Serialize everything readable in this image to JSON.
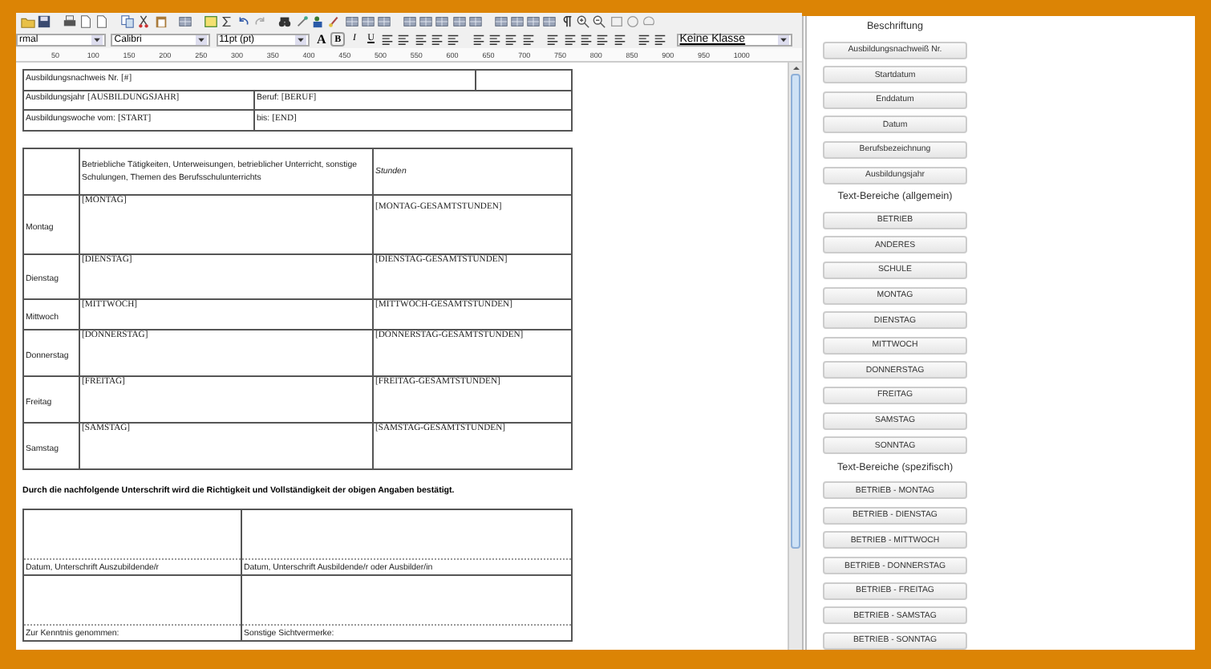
{
  "toolbar": {
    "style_select": "rmal",
    "font_select": "Calibri",
    "size_select": "11pt (pt)",
    "format_buttons": [
      "A",
      "B",
      "I",
      "U"
    ],
    "class_select": "Keine Klasse"
  },
  "ruler": [
    "50",
    "100",
    "150",
    "200",
    "250",
    "300",
    "350",
    "400",
    "450",
    "500",
    "550",
    "600",
    "650",
    "700",
    "750",
    "800",
    "850",
    "900",
    "950",
    "1000"
  ],
  "document": {
    "header_table": [
      [
        {
          "label": "Ausbildungsnachweis Nr.",
          "value": "[#]"
        }
      ],
      [
        {
          "label": "Ausbildungsjahr",
          "value": "[AUSBILDUNGSJAHR]"
        },
        {
          "label": "Beruf:",
          "value": "[BERUF]"
        }
      ],
      [
        {
          "label": "Ausbildungswoche vom:",
          "value": "[START]"
        },
        {
          "label": "bis:",
          "value": "[END]"
        }
      ]
    ],
    "activity_table": {
      "columns": [
        "Betriebliche Tätigkeiten, Unterweisungen, betrieblicher Unterricht, sonstige Schulungen, Themen des Berufsschulunterrichts",
        "Stunden"
      ],
      "rows": [
        {
          "day": "Montag",
          "activity": "[MONTAG]",
          "hours": "[MONTAG-GESAMTSTUNDEN]"
        },
        {
          "day": "Dienstag",
          "activity": "[DIENSTAG]",
          "hours": "[DIENSTAG-GESAMTSTUNDEN]"
        },
        {
          "day": "Mittwoch",
          "activity": "[MITTWOCH]",
          "hours": "[MITTWOCH-GESAMTSTUNDEN]"
        },
        {
          "day": "Donnerstag",
          "activity": "[DONNERSTAG]",
          "hours": "[DONNERSTAG-GESAMTSTUNDEN]"
        },
        {
          "day": "Freitag",
          "activity": "[FREITAG]",
          "hours": "[FREITAG-GESAMTSTUNDEN]"
        },
        {
          "day": "Samstag",
          "activity": "[SAMSTAG]",
          "hours": "[SAMSTAG-GESAMTSTUNDEN]"
        }
      ]
    },
    "confirmation": "Durch die nachfolgende Unterschrift wird die Richtigkeit und Vollständigkeit der obigen Angaben bestätigt.",
    "signature_table": [
      [
        "Datum, Unterschrift Auszubildende/r",
        "Datum, Unterschrift Ausbildende/r oder Ausbilder/in"
      ],
      [
        "Zur Kenntnis genommen:",
        "Sonstige Sichtvermerke:"
      ]
    ]
  },
  "panel": [
    {
      "heading": "Beschriftung",
      "buttons": [
        "Ausbildungsnachweiß Nr.",
        "Startdatum",
        "Enddatum",
        "Datum",
        "Berufsbezeichnung",
        "Ausbildungsjahr"
      ]
    },
    {
      "heading": "Text-Bereiche (allgemein)",
      "buttons": [
        "BETRIEB",
        "ANDERES",
        "SCHULE",
        "MONTAG",
        "DIENSTAG",
        "MITTWOCH",
        "DONNERSTAG",
        "FREITAG",
        "SAMSTAG",
        "SONNTAG"
      ]
    },
    {
      "heading": "Text-Bereiche (spezifisch)",
      "buttons": [
        "BETRIEB - MONTAG",
        "BETRIEB - DIENSTAG",
        "BETRIEB - MITTWOCH",
        "BETRIEB - DONNERSTAG",
        "BETRIEB - FREITAG",
        "BETRIEB - SAMSTAG",
        "BETRIEB - SONNTAG"
      ]
    }
  ]
}
